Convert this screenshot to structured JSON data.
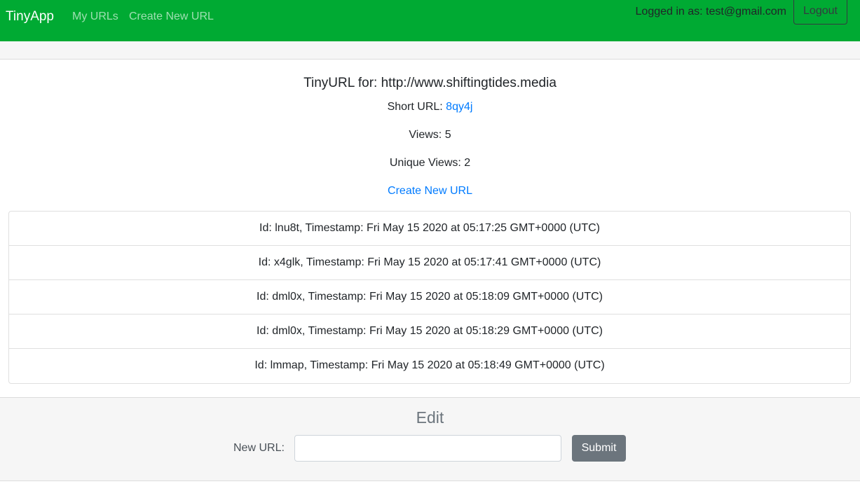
{
  "nav": {
    "brand": "TinyApp",
    "links": [
      "My URLs",
      "Create New URL"
    ],
    "logged_in_text": "Logged in as: test@gmail.com",
    "logout_label": "Logout"
  },
  "details": {
    "title": "TinyURL for: http://www.shiftingtides.media",
    "short_url_label": "Short URL: ",
    "short_url": "8qy4j",
    "views": "Views: 5",
    "unique_views": "Unique Views: 2",
    "create_link": "Create New URL"
  },
  "visits": [
    "Id: lnu8t, Timestamp: Fri May 15 2020 at 05:17:25 GMT+0000 (UTC)",
    "Id: x4glk, Timestamp: Fri May 15 2020 at 05:17:41 GMT+0000 (UTC)",
    "Id: dml0x, Timestamp: Fri May 15 2020 at 05:18:09 GMT+0000 (UTC)",
    "Id: dml0x, Timestamp: Fri May 15 2020 at 05:18:29 GMT+0000 (UTC)",
    "Id: lmmap, Timestamp: Fri May 15 2020 at 05:18:49 GMT+0000 (UTC)"
  ],
  "edit": {
    "title": "Edit",
    "new_url_label": "New URL:",
    "new_url_value": "",
    "submit_label": "Submit"
  },
  "colors": {
    "navbar": "#00aa33",
    "link": "#007bff",
    "submit": "#6c757d"
  }
}
